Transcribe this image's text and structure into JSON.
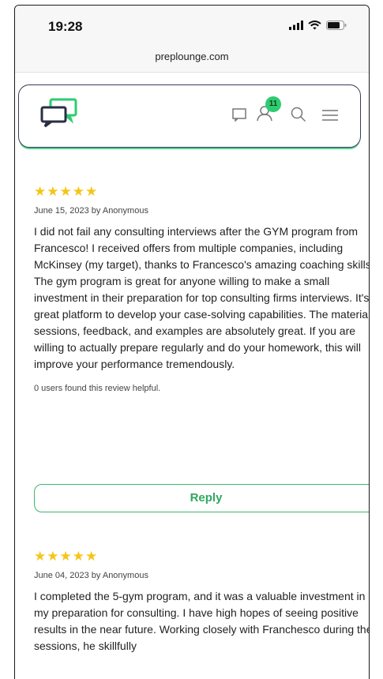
{
  "status_bar": {
    "time": "19:28"
  },
  "browser": {
    "url": "preplounge.com"
  },
  "header": {
    "notification_count": "11",
    "accent": "#2ecc71"
  },
  "reviews": [
    {
      "stars": "★★★★★",
      "meta": "June 15, 2023 by Anonymous",
      "para1": "I did not fail any consulting interviews after the GYM program from Francesco! I received offers from multiple companies, including McKinsey (my target), thanks to Francesco's amazing coaching skills.",
      "para2": "The gym program is great for anyone willing to make a small investment in their preparation for top consulting firms interviews. It's a great platform to develop your case-solving capabilities. The materials, sessions, feedback, and examples are absolutely great. If you are willing to actually prepare regularly and do your homework, this will improve your performance tremendously.",
      "helpful": "0 users found this review helpful.",
      "reply_label": "Reply"
    },
    {
      "stars": "★★★★★",
      "meta": "June 04, 2023 by Anonymous",
      "para1": "I completed the 5-gym program, and it was a valuable investment in my preparation for consulting. I have high hopes of seeing positive results in the near future. Working closely with Franchesco during the sessions, he skillfully"
    }
  ]
}
